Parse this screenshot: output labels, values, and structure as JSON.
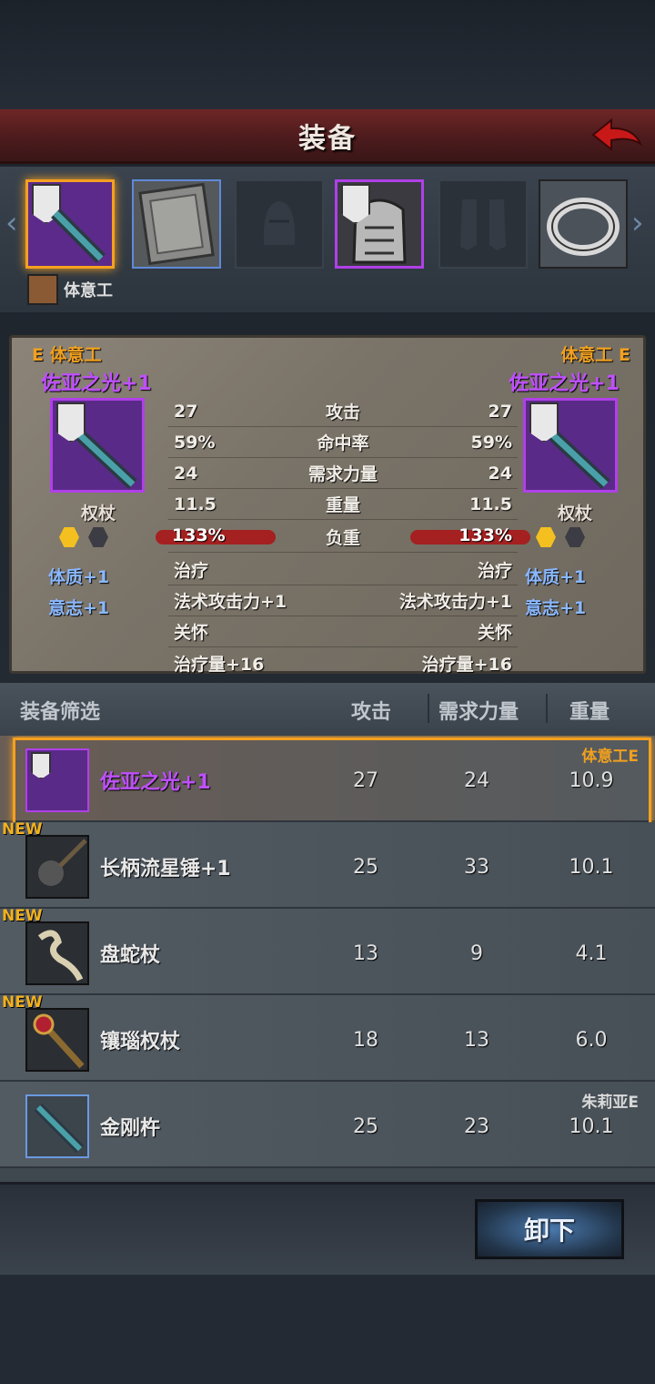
{
  "title": "装备",
  "character": {
    "name": "体意工"
  },
  "compare": {
    "left": {
      "owner": "E 体意工",
      "name": "佐亚之光+1",
      "type": "权杖",
      "bonuses": [
        "体质+1",
        "意志+1"
      ]
    },
    "right": {
      "owner": "体意工 E",
      "name": "佐亚之光+1",
      "type": "权杖",
      "bonuses": [
        "体质+1",
        "意志+1"
      ]
    },
    "stats": [
      {
        "label": "攻击",
        "left": "27",
        "right": "27"
      },
      {
        "label": "命中率",
        "left": "59%",
        "right": "59%"
      },
      {
        "label": "需求力量",
        "left": "24",
        "right": "24"
      },
      {
        "label": "重量",
        "left": "11.5",
        "right": "11.5"
      },
      {
        "label": "负重",
        "left": "133%",
        "right": "133%"
      }
    ],
    "effects": [
      {
        "left": "治疗",
        "right": "治疗"
      },
      {
        "left": "法术攻击力+1",
        "right": "法术攻击力+1"
      },
      {
        "left": "关怀",
        "right": "关怀"
      },
      {
        "left": "治疗量+16",
        "right": "治疗量+16"
      }
    ]
  },
  "list_header": {
    "filter": "装备筛选",
    "attack": "攻击",
    "str_req": "需求力量",
    "weight": "重量"
  },
  "items": [
    {
      "name": "佐亚之光+1",
      "attack": "27",
      "str": "24",
      "weight": "10.9",
      "tag": "体意工E",
      "new": ""
    },
    {
      "name": "长柄流星锤+1",
      "attack": "25",
      "str": "33",
      "weight": "10.1",
      "tag": "",
      "new": "NEW"
    },
    {
      "name": "盘蛇杖",
      "attack": "13",
      "str": "9",
      "weight": "4.1",
      "tag": "",
      "new": "NEW"
    },
    {
      "name": "镶瑙权杖",
      "attack": "18",
      "str": "13",
      "weight": "6.0",
      "tag": "",
      "new": "NEW"
    },
    {
      "name": "金刚杵",
      "attack": "25",
      "str": "23",
      "weight": "10.1",
      "tag": "朱莉亚E",
      "new": ""
    }
  ],
  "unequip_label": "卸下"
}
